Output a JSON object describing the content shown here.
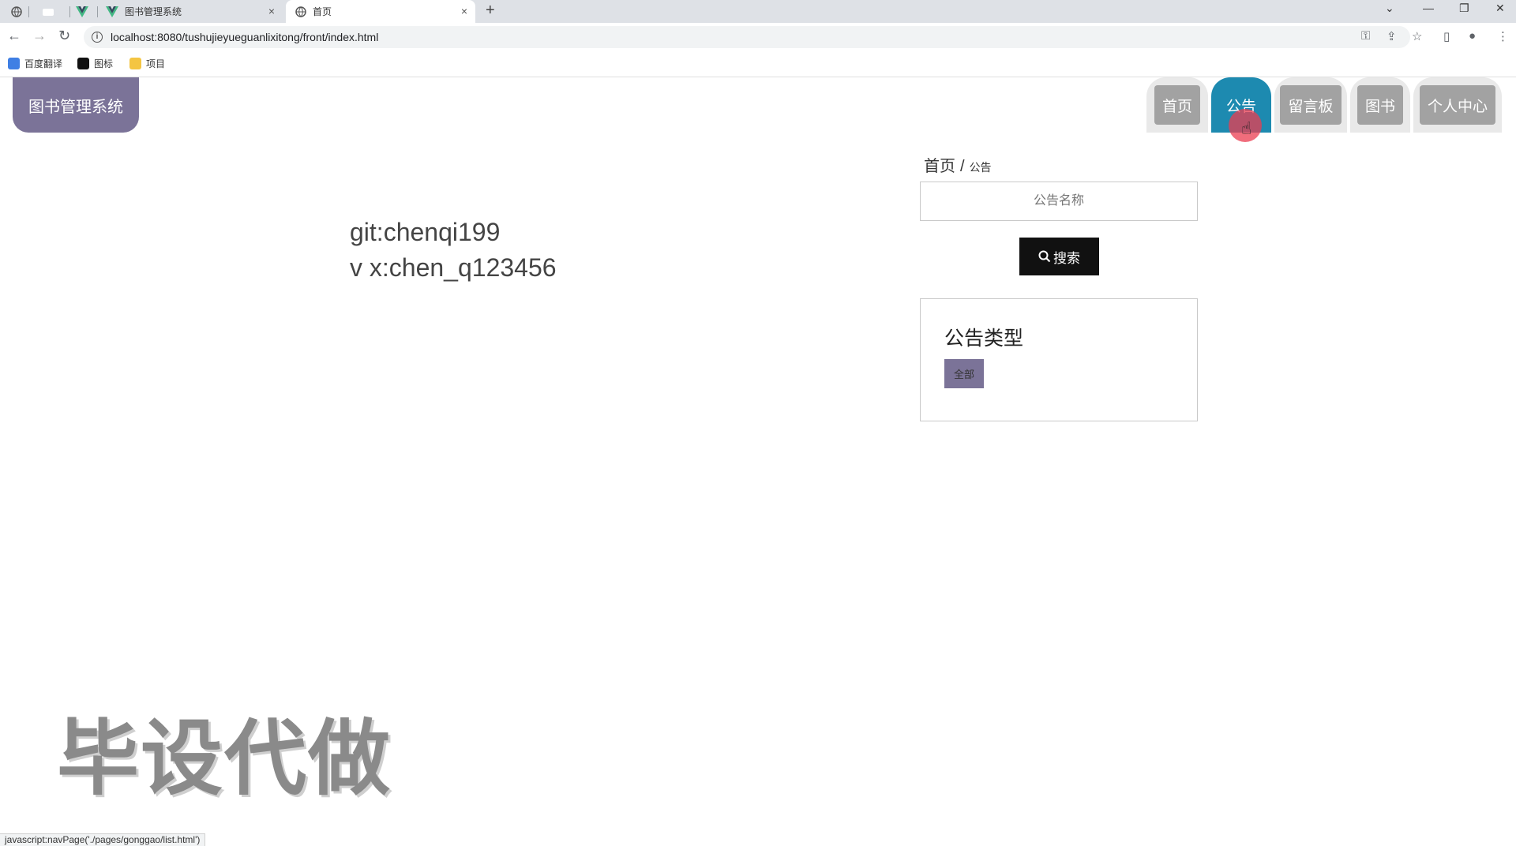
{
  "browser": {
    "tabs": [
      {
        "title": "图书管理系统",
        "close": "×"
      },
      {
        "title": "首页",
        "close": "×"
      }
    ],
    "new_tab": "+",
    "url": "localhost:8080/tushujieyueguanlixitong/front/index.html",
    "bookmarks": [
      {
        "label": "百度翻译"
      },
      {
        "label": "图标"
      },
      {
        "label": "项目"
      }
    ]
  },
  "site": {
    "logo": "图书管理系统",
    "nav": [
      {
        "label": "首页"
      },
      {
        "label": "公告"
      },
      {
        "label": "留言板"
      },
      {
        "label": "图书"
      },
      {
        "label": "个人中心"
      }
    ]
  },
  "breadcrumb": {
    "home": "首页",
    "sep": "/",
    "current": "公告"
  },
  "search": {
    "placeholder": "公告名称",
    "button_label": "搜索"
  },
  "type_panel": {
    "title": "公告类型",
    "chip": "全部"
  },
  "contact": {
    "line1": "git:chenqi199",
    "line2": "v x:chen_q123456"
  },
  "watermark": "毕设代做",
  "status_bar": "javascript:navPage('./pages/gonggao/list.html')",
  "colors": {
    "accent": "#7b7398",
    "nav_active": "#1d8ab0",
    "nav_inactive": "#a2a2a2"
  }
}
